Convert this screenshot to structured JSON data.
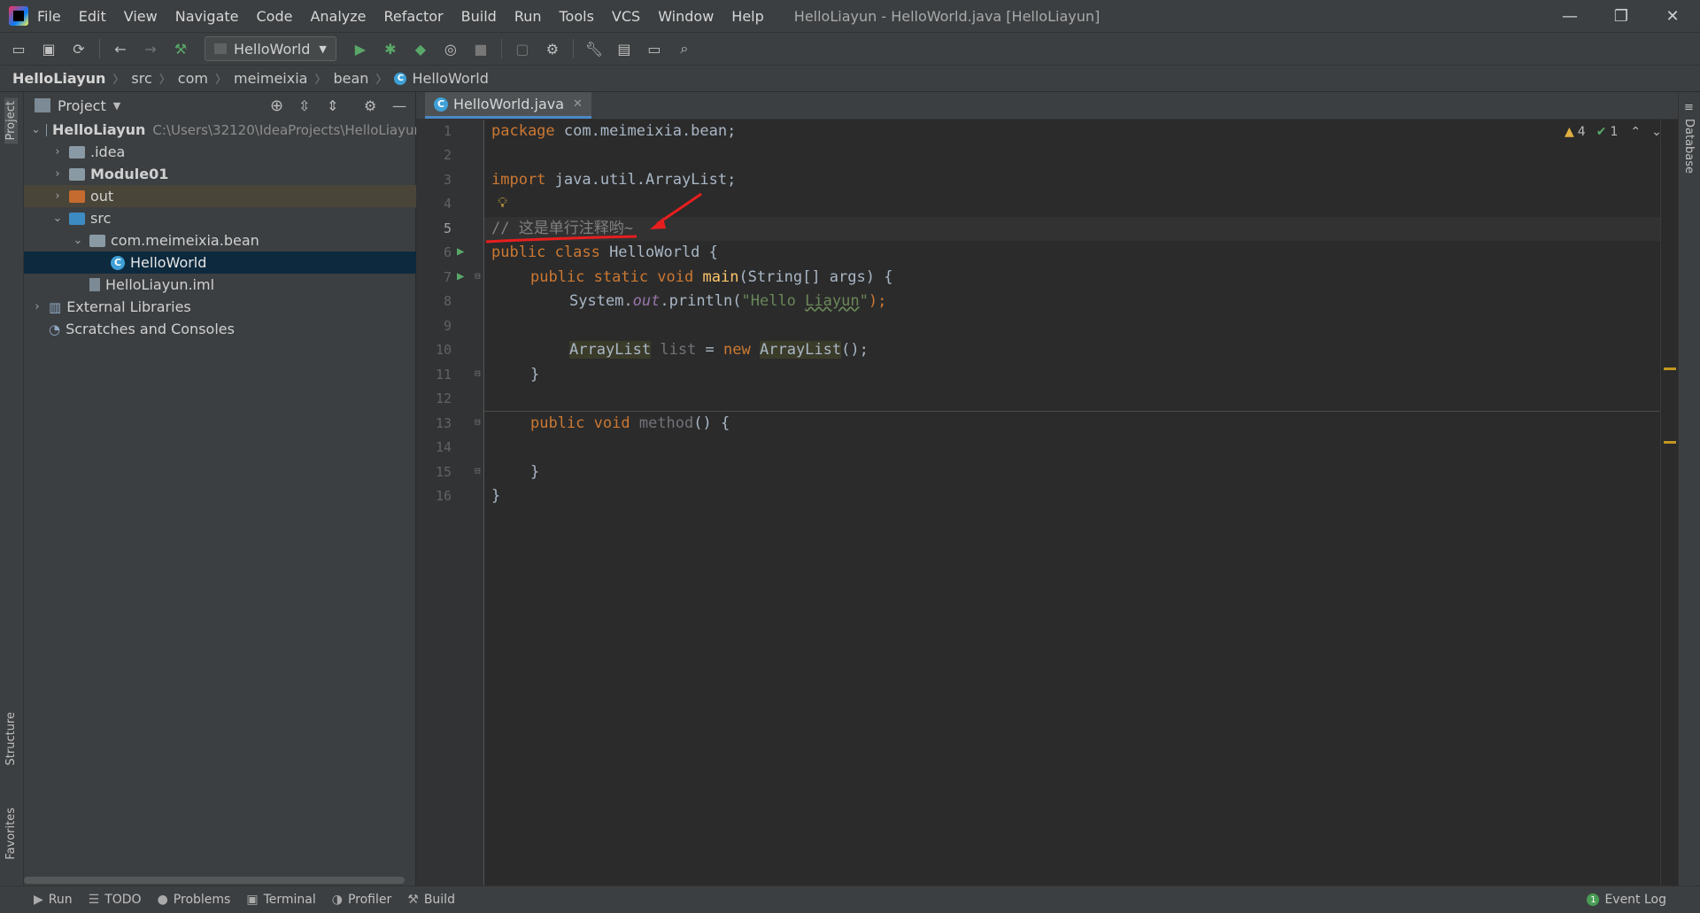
{
  "menubar": {
    "items": [
      "File",
      "Edit",
      "View",
      "Navigate",
      "Code",
      "Analyze",
      "Refactor",
      "Build",
      "Run",
      "Tools",
      "VCS",
      "Window",
      "Help"
    ],
    "window_title": "HelloLiayun - HelloWorld.java [HelloLiayun]"
  },
  "toolbar": {
    "run_config": "HelloWorld"
  },
  "breadcrumb": [
    "HelloLiayun",
    "src",
    "com",
    "meimeixia",
    "bean",
    "HelloWorld"
  ],
  "left_stripe": {
    "project": "Project",
    "structure": "Structure",
    "favorites": "Favorites"
  },
  "right_stripe": {
    "database": "Database"
  },
  "project_panel": {
    "title": "Project",
    "tree": [
      {
        "label": "HelloLiayun",
        "path": "C:\\Users\\32120\\IdeaProjects\\HelloLiayun"
      },
      {
        "label": ".idea"
      },
      {
        "label": "Module01"
      },
      {
        "label": "out"
      },
      {
        "label": "src"
      },
      {
        "label": "com.meimeixia.bean"
      },
      {
        "label": "HelloWorld"
      },
      {
        "label": "HelloLiayun.iml"
      },
      {
        "label": "External Libraries"
      },
      {
        "label": "Scratches and Consoles"
      }
    ]
  },
  "editor": {
    "tab": "HelloWorld.java",
    "warnings": "4",
    "weak": "1",
    "line_numbers": [
      "1",
      "2",
      "3",
      "4",
      "5",
      "6",
      "7",
      "8",
      "9",
      "10",
      "11",
      "12",
      "13",
      "14",
      "15",
      "16"
    ],
    "code": {
      "l1_kw": "package",
      "l1_rest": " com.meimeixia.bean;",
      "l3_kw": "import",
      "l3_rest": " java.util.ArrayList;",
      "l5": "// 这是单行注释哟~",
      "l6_kw": "public class",
      "l6_rest": " HelloWorld {",
      "l7_kw": "public static void",
      "l7_fn": "main",
      "l7_rest": "(String[] args) {",
      "l8_a": "System.",
      "l8_out": "out",
      "l8_b": ".println(",
      "l8_str1": "\"Hello ",
      "l8_str2": "Liayun",
      "l8_str3": "\"",
      "l8_end": ");",
      "l10_t1": "ArrayList",
      "l10_var": " list",
      "l10_eq": " = ",
      "l10_new": "new",
      "l10_t2": "ArrayList",
      "l10_end": "();",
      "l11": "}",
      "l13_kw": "public void",
      "l13_fn": "method",
      "l13_rest": "() {",
      "l15": "}",
      "l16": "}"
    }
  },
  "statusbar": {
    "run": "Run",
    "todo": "TODO",
    "problems": "Problems",
    "terminal": "Terminal",
    "profiler": "Profiler",
    "build": "Build",
    "event_log": "Event Log",
    "event_count": "1"
  },
  "colors": {
    "accent": "#4a88c7",
    "keyword": "#cc7832",
    "string": "#6a8759",
    "comment": "#808080",
    "annotation_red": "#e81e1e"
  }
}
